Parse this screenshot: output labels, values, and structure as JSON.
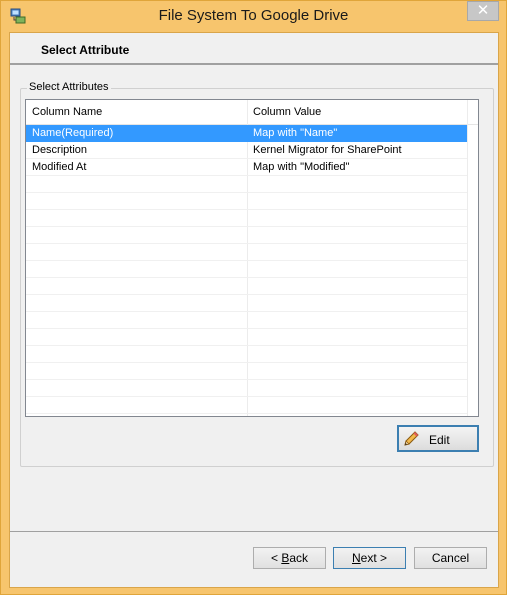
{
  "window": {
    "title": "File System To Google Drive",
    "close_glyph": "✕"
  },
  "header": {
    "title": "Select Attribute"
  },
  "group": {
    "label": "Select Attributes"
  },
  "grid": {
    "columns": [
      "Column Name",
      "Column Value"
    ],
    "rows": [
      {
        "name": "Name(Required)",
        "value": "Map with \"Name\""
      },
      {
        "name": "Description",
        "value": "Kernel Migrator for SharePoint"
      },
      {
        "name": "Modified At",
        "value": "Map with \"Modified\""
      }
    ],
    "selected_row": 0
  },
  "buttons": {
    "edit": "Edit",
    "back_mnemonic": "B",
    "back_rest": "ack",
    "next_mnemonic": "N",
    "next_rest": "ext >",
    "cancel": "Cancel",
    "back_prefix": "< "
  },
  "colors": {
    "accent": "#3399ff",
    "frame": "#f7c56d"
  },
  "icons": {
    "app": "app-drive-icon",
    "edit": "pencil-icon",
    "close": "close-icon"
  }
}
